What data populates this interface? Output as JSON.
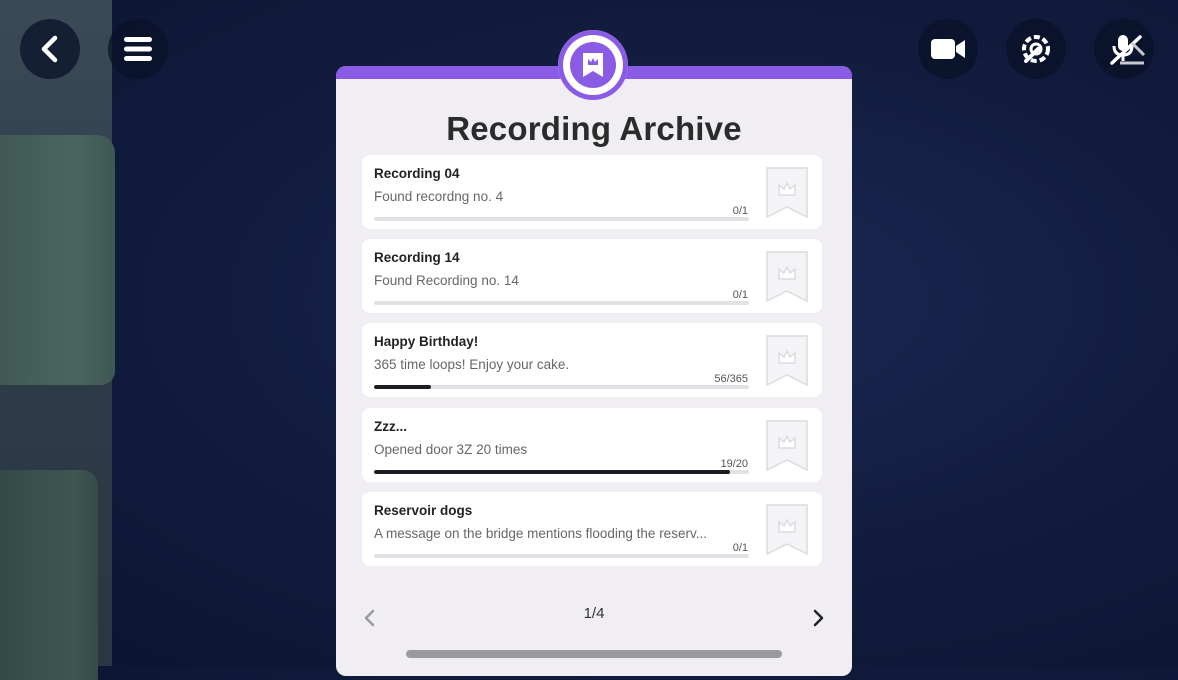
{
  "panel": {
    "title": "Recording Archive",
    "accent_color": "#8a5ce6",
    "badge_icon": "bookmark-crown-icon"
  },
  "toolbar": {
    "left": [
      {
        "icon": "back-chevron-icon"
      },
      {
        "icon": "menu-icon"
      }
    ],
    "right": [
      {
        "icon": "video-camera-icon"
      },
      {
        "icon": "settings-wrench-icon"
      },
      {
        "icon": "microphone-muted-icon"
      }
    ]
  },
  "achievements": [
    {
      "title": "Recording 04",
      "description": "Found recordng no. 4",
      "count": "0/1",
      "progress": 0.0
    },
    {
      "title": "Recording 14",
      "description": "Found Recording no. 14",
      "count": "0/1",
      "progress": 0.0
    },
    {
      "title": "Happy  Birthday!",
      "description": "365 time loops! Enjoy your cake.",
      "count": "56/365",
      "progress": 0.153
    },
    {
      "title": "Zzz...",
      "description": "Opened door 3Z 20 times",
      "count": "19/20",
      "progress": 0.95
    },
    {
      "title": "Reservoir dogs",
      "description": "A message on the bridge mentions flooding the reserv...",
      "count": "0/1",
      "progress": 0.0
    }
  ],
  "pager": {
    "label": "1/4"
  }
}
